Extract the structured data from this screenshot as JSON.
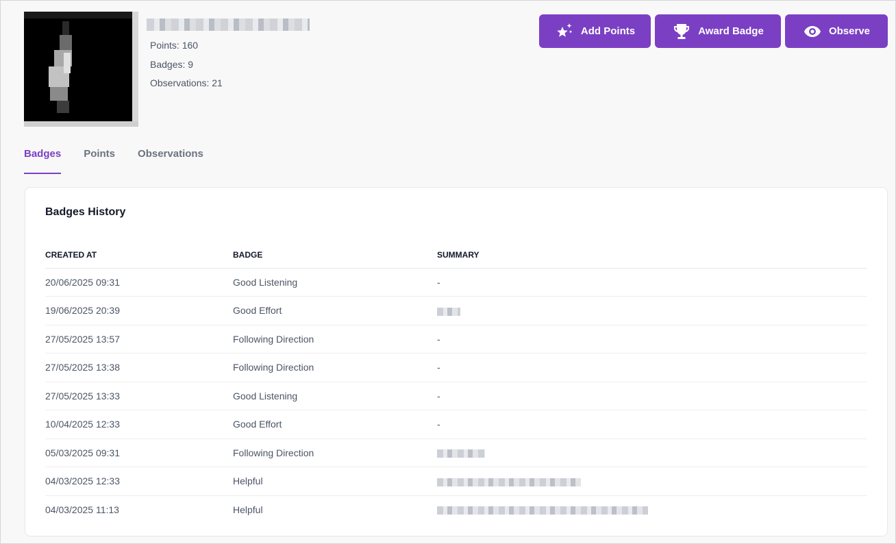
{
  "profile": {
    "stats": {
      "points": "Points: 160",
      "badges": "Badges: 9",
      "observations": "Observations: 21"
    }
  },
  "actions": {
    "add_points": "Add Points",
    "award_badge": "Award Badge",
    "observe": "Observe"
  },
  "tabs": [
    {
      "label": "Badges",
      "active": true
    },
    {
      "label": "Points",
      "active": false
    },
    {
      "label": "Observations",
      "active": false
    }
  ],
  "history": {
    "title": "Badges History",
    "columns": [
      "CREATED AT",
      "BADGE",
      "SUMMARY"
    ],
    "rows": [
      {
        "created_at": "20/06/2025 09:31",
        "badge": "Good Listening",
        "summary": "-"
      },
      {
        "created_at": "19/06/2025 20:39",
        "badge": "Good Effort",
        "summary": ""
      },
      {
        "created_at": "27/05/2025 13:57",
        "badge": "Following Direction",
        "summary": "-"
      },
      {
        "created_at": "27/05/2025 13:38",
        "badge": "Following Direction",
        "summary": "-"
      },
      {
        "created_at": "27/05/2025 13:33",
        "badge": "Good Listening",
        "summary": "-"
      },
      {
        "created_at": "10/04/2025 12:33",
        "badge": "Good Effort",
        "summary": "-"
      },
      {
        "created_at": "05/03/2025 09:31",
        "badge": "Following Direction",
        "summary": ""
      },
      {
        "created_at": "04/03/2025 12:33",
        "badge": "Helpful",
        "summary": ""
      },
      {
        "created_at": "04/03/2025 11:13",
        "badge": "Helpful",
        "summary": ""
      }
    ]
  },
  "colors": {
    "accent": "#7b3fc4",
    "background": "#f8f8f8",
    "card": "#ffffff"
  },
  "icons": {
    "add_points": "sparkle-star-icon",
    "award_badge": "trophy-icon",
    "observe": "eye-icon"
  }
}
